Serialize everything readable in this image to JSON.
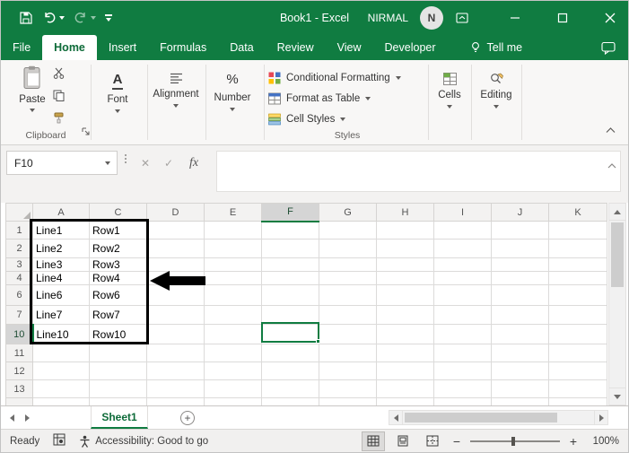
{
  "title_bar": {
    "title": "Book1 - Excel",
    "user_name": "NIRMAL",
    "avatar_initial": "N"
  },
  "menu_bar": {
    "tabs": [
      "File",
      "Home",
      "Insert",
      "Formulas",
      "Data",
      "Review",
      "View",
      "Developer"
    ],
    "tell_me_label": "Tell me"
  },
  "ribbon": {
    "paste_label": "Paste",
    "clipboard_group_label": "Clipboard",
    "font_label": "Font",
    "font_glyph": "A",
    "alignment_label": "Alignment",
    "number_label": "Number",
    "number_glyph": "%",
    "conditional_formatting_label": "Conditional Formatting",
    "format_as_table_label": "Format as Table",
    "cell_styles_label": "Cell Styles",
    "styles_group_label": "Styles",
    "cells_label": "Cells",
    "editing_label": "Editing"
  },
  "formula_bar": {
    "name_box_value": "F10",
    "cancel_glyph": "✕",
    "enter_glyph": "✓",
    "fx_label": "fx",
    "formula_value": ""
  },
  "grid": {
    "columns": [
      "A",
      "C",
      "D",
      "E",
      "F",
      "G",
      "H",
      "I",
      "J",
      "K"
    ],
    "rows": [
      "1",
      "2",
      "3",
      "4",
      "6",
      "7",
      "10",
      "11",
      "12",
      "13"
    ],
    "selected_column": "F",
    "selected_row": "10",
    "cells": {
      "r1": {
        "a": "Line1",
        "c": "Row1"
      },
      "r2": {
        "a": "Line2",
        "c": "Row2"
      },
      "r3": {
        "a": "Line3",
        "c": "Row3"
      },
      "r4": {
        "a": "Line4",
        "c": "Row4"
      },
      "r6": {
        "a": "Line6",
        "c": "Row6"
      },
      "r7": {
        "a": "Line7",
        "c": "Row7"
      },
      "r10": {
        "a": "Line10",
        "c": "Row10"
      }
    }
  },
  "sheet_bar": {
    "sheet_name": "Sheet1",
    "new_sheet_glyph": "+"
  },
  "status_bar": {
    "ready_label": "Ready",
    "accessibility_label": "Accessibility: Good to go",
    "zoom_out_glyph": "−",
    "zoom_in_glyph": "+",
    "zoom_value": "100%"
  }
}
